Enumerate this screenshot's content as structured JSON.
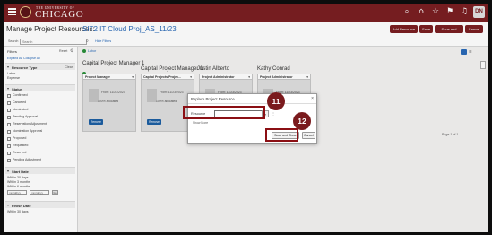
{
  "header": {
    "brand_small": "THE UNIVERSITY OF",
    "brand_name": "CHICAGO",
    "icons": [
      "search-icon",
      "home-icon",
      "star-icon",
      "flag-icon",
      "bell-icon"
    ],
    "avatar": "DN"
  },
  "title_row": {
    "page_title": "Manage Project Resources:",
    "project": "SIT2 IT Cloud Proj_AS_11/23",
    "buttons": [
      "Add Resource",
      "Save",
      "Save and Close",
      "Cancel"
    ]
  },
  "search_row": {
    "label": "Search",
    "placeholder": "Search",
    "hide_filters": "Hide Filters"
  },
  "filters": {
    "title": "Filters",
    "reset": "Reset",
    "expand_collapse": "Expand All  Collapse All",
    "resource_type": {
      "title": "Resource Type",
      "right": "Clear",
      "values": [
        "Labor",
        "Expense"
      ]
    },
    "status": {
      "title": "Status",
      "options": [
        "Confirmed",
        "Canceled",
        "Nominated",
        "Pending Approval",
        "Reservation Adjustment",
        "Nomination Approval",
        "Proposed",
        "Requested",
        "Reserved",
        "Pending Adjustment"
      ]
    },
    "start_date": {
      "title": "Start Date",
      "options": [
        "Within 30 days",
        "Within 3 months",
        "Within 6 months"
      ],
      "from": "mm/dd/yy",
      "to": "mm/dd/yy",
      "go": "Go"
    },
    "finish_date": {
      "title": "Finish Date",
      "options": [
        "Within 30 days"
      ]
    }
  },
  "main": {
    "legend": "Labor",
    "groups": [
      "Capital Project Manager 1",
      "Capital Project Manager 1",
      "Justin Alberto",
      "Kathy Conrad"
    ],
    "columns": [
      {
        "head": "Project Manager",
        "from": "From: 11/23/2023",
        "msg": "100% allocated",
        "button": "Remove"
      },
      {
        "head": "Capital Projects Projec...",
        "from": "From: 11/23/2023",
        "msg": "100% allocated",
        "button": "Remove"
      },
      {
        "head": "Project Administrator",
        "from": "From: 11/23/2023",
        "msg": "",
        "button": ""
      },
      {
        "head": "Project Administrator",
        "from": "From: 11/23/2023",
        "msg": "",
        "button": ""
      }
    ],
    "pager": "Page 1 of 1"
  },
  "dialog": {
    "title": "Replace Project Resource",
    "resource_label": "Resource",
    "resource_value": "",
    "show_more": "Show More",
    "save_close": "Save and Close",
    "cancel": "Cancel"
  },
  "callouts": [
    "11",
    "12"
  ],
  "colors": {
    "brand": "#7a1f22",
    "link": "#2a6ab8",
    "callout": "#7a1a1d",
    "highlight": "#8b0f14"
  }
}
